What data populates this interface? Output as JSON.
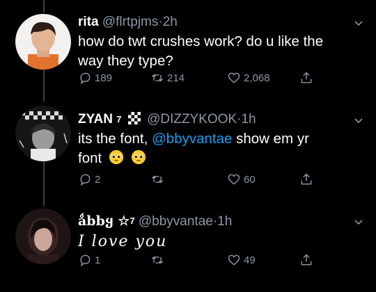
{
  "tweets": [
    {
      "name": "rita",
      "handle": "@flrtpjms",
      "dot": "·",
      "time": "2h",
      "text_line1": "how do twt crushes work? do u like the",
      "text_line2": "way they type?",
      "replies": "189",
      "retweets": "214",
      "likes": "2,068"
    },
    {
      "name": "ZYAN",
      "badge": "7",
      "handle": "@DIZZYKOOK",
      "dot": "·",
      "time": "1h",
      "text_line1_a": "its the font, ",
      "mention": "@bbyvantae",
      "text_line1_b": " show em yr",
      "text_line2": "font",
      "replies": "2",
      "retweets": "",
      "likes": "60"
    },
    {
      "name": "ǻbbყ ☆",
      "badge": "7",
      "handle": "@bbyvantae",
      "dot": "·",
      "time": "1h",
      "text_line1": "I love you",
      "replies": "1",
      "retweets": "",
      "likes": "49"
    }
  ],
  "icons": {
    "reply": "reply-icon",
    "retweet": "retweet-icon",
    "like": "heart-icon",
    "share": "share-icon",
    "more": "chevron-down-icon",
    "emoji": "pleading-face-emoji",
    "checker": "checkered-flag-emoji"
  },
  "colors": {
    "background": "#000000",
    "text": "#ffffff",
    "secondary": "#8b98a5",
    "mention": "#1d9bf0",
    "thread": "#3d4248"
  }
}
